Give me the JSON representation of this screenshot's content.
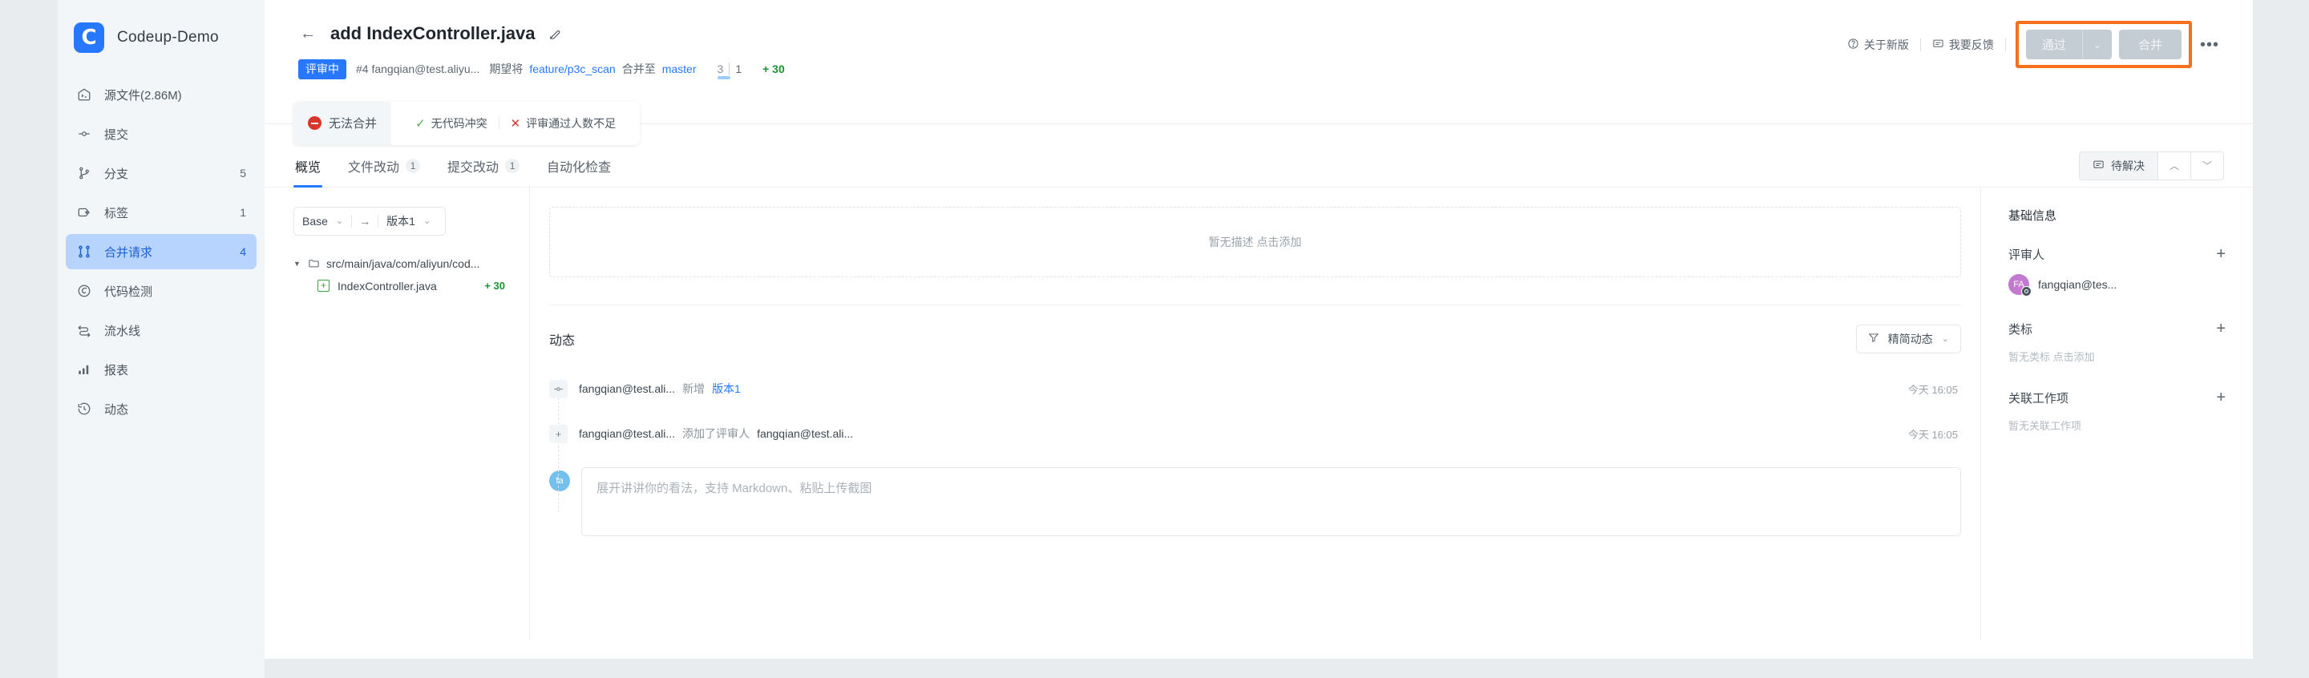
{
  "sidebar": {
    "brand": {
      "name": "Codeup-Demo",
      "logo_letter": "C",
      "logo_color": "#2878ff"
    },
    "items": [
      {
        "label": "源文件(2.86M)",
        "count": "",
        "icon": "source-file-icon",
        "active": false
      },
      {
        "label": "提交",
        "count": "",
        "icon": "commit-icon",
        "active": false
      },
      {
        "label": "分支",
        "count": "5",
        "icon": "branch-icon",
        "active": false
      },
      {
        "label": "标签",
        "count": "1",
        "icon": "tag-icon",
        "active": false
      },
      {
        "label": "合并请求",
        "count": "4",
        "icon": "merge-request-icon",
        "active": true
      },
      {
        "label": "代码检测",
        "count": "",
        "icon": "code-scan-icon",
        "active": false
      },
      {
        "label": "流水线",
        "count": "",
        "icon": "pipeline-icon",
        "active": false
      },
      {
        "label": "报表",
        "count": "",
        "icon": "report-icon",
        "active": false
      },
      {
        "label": "动态",
        "count": "",
        "icon": "activity-icon",
        "active": false
      }
    ]
  },
  "header": {
    "back_label": "←",
    "title": "add IndexController.java",
    "state_badge": "评审中",
    "meta_id_author": "#4 fangqian@test.aliyu...",
    "meta_expect": "期望将",
    "source_branch": "feature/p3c_scan",
    "meta_merge_to": "合并至",
    "target_branch": "master",
    "count_a": "3",
    "count_b": "1",
    "added_lines": "+ 30",
    "about_new": "关于新版",
    "feedback": "我要反馈",
    "approve_label": "通过",
    "merge_label": "合并",
    "more_label": "•••",
    "highlight_color": "#f4701b"
  },
  "status": {
    "blocked_label": "无法合并",
    "checks": [
      {
        "label": "无代码冲突",
        "state": "ok",
        "glyph": "✓"
      },
      {
        "label": "评审通过人数不足",
        "state": "fail",
        "glyph": "✕"
      }
    ]
  },
  "tabs": [
    {
      "label": "概览",
      "badge": "",
      "active": true
    },
    {
      "label": "文件改动",
      "badge": "1",
      "active": false
    },
    {
      "label": "提交改动",
      "badge": "1",
      "active": false
    },
    {
      "label": "自动化检查",
      "badge": "",
      "active": false
    }
  ],
  "resolve": {
    "label": "待解决",
    "prev": "︿",
    "next": "﹀"
  },
  "tree": {
    "base_label": "Base",
    "arrow": "→",
    "version_label": "版本1",
    "folder": "src/main/java/com/aliyun/cod...",
    "file": {
      "name": "IndexController.java",
      "added": "+ 30"
    }
  },
  "description": {
    "placeholder": "暂无描述 点击添加"
  },
  "activity": {
    "title": "动态",
    "filter_label": "精简动态",
    "entries": [
      {
        "icon": "commit-icon",
        "author": "fangqian@test.ali...",
        "action": "新增",
        "target": "版本1",
        "target_is_link": true,
        "time": "今天 16:05"
      },
      {
        "icon": "plus-icon",
        "author": "fangqian@test.ali...",
        "action": "添加了评审人",
        "target": "fangqian@test.ali...",
        "target_is_link": false,
        "time": "今天 16:05"
      }
    ],
    "comment": {
      "avatar_initials": "fa",
      "placeholder": "展开讲讲你的看法，支持 Markdown、粘贴上传截图"
    }
  },
  "right_panel": {
    "title": "基础信息",
    "reviewer": {
      "label": "评审人",
      "add": "+",
      "name": "fangqian@tes...",
      "avatar_initials": "FA",
      "avatar_color": "#c479d0"
    },
    "labels": {
      "label": "类标",
      "add": "+",
      "empty": "暂无类标 点击添加"
    },
    "work_items": {
      "label": "关联工作项",
      "add": "+",
      "empty": "暂无关联工作项"
    }
  }
}
